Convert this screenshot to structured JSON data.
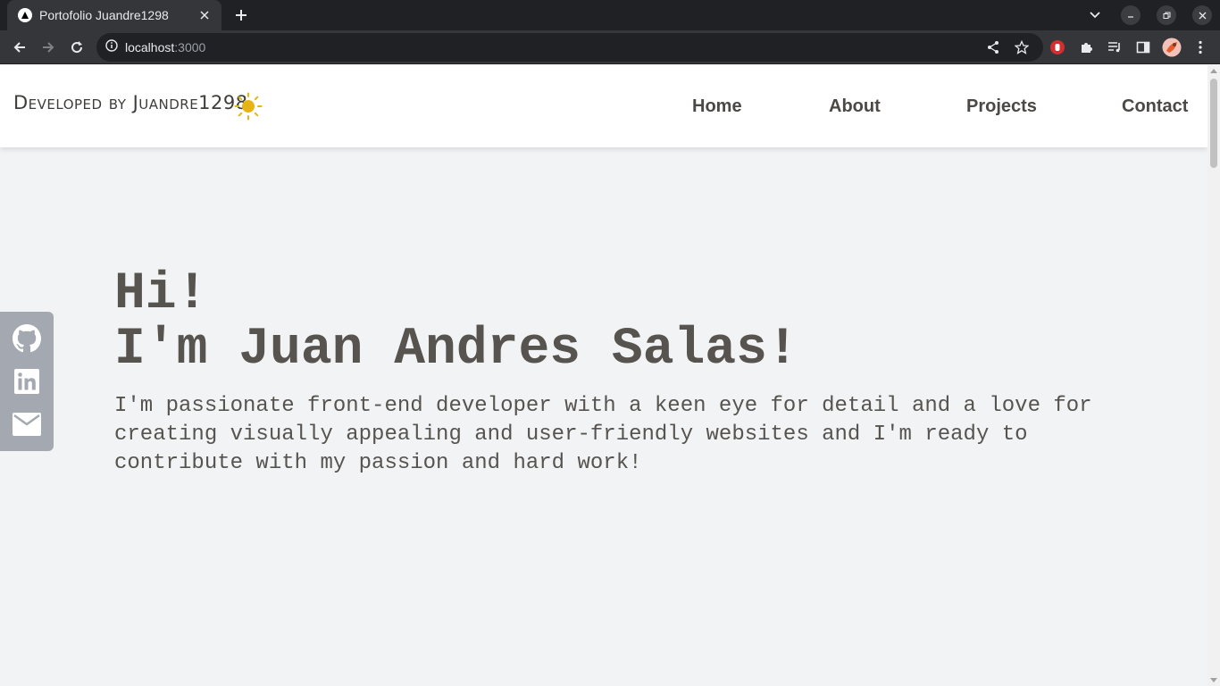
{
  "browser": {
    "tab_title": "Portofolio Juandre1298",
    "url_host": "localhost",
    "url_port": ":3000",
    "icons": [
      "tab-favicon-icon",
      "tab-close-icon",
      "new-tab-icon",
      "tab-search-icon",
      "minimize-icon",
      "restore-icon",
      "close-window-icon",
      "back-icon",
      "forward-icon",
      "reload-icon",
      "site-info-icon",
      "share-icon",
      "bookmark-star-icon",
      "extension-stop-icon",
      "extensions-puzzle-icon",
      "media-control-icon",
      "side-panel-icon",
      "profile-avatar-icon",
      "menu-dots-icon"
    ]
  },
  "navbar": {
    "brand": "Developed by Juandre1298",
    "theme_icon": "sun-icon",
    "links": [
      "Home",
      "About",
      "Projects",
      "Contact"
    ]
  },
  "social": {
    "icons": [
      "github-icon",
      "linkedin-icon",
      "mail-icon"
    ]
  },
  "hero": {
    "greeting": "Hi!",
    "name": "I'm Juan Andres Salas!",
    "description": "I'm passionate front-end developer with a keen eye for detail and a love for creating visually appealing and user-friendly websites and I'm ready to contribute with my passion and hard work!"
  },
  "colors": {
    "text": "#575450",
    "sidebar": "#a4a8b0",
    "sun": "#e8b414",
    "page_bg": "#f2f3f5"
  }
}
